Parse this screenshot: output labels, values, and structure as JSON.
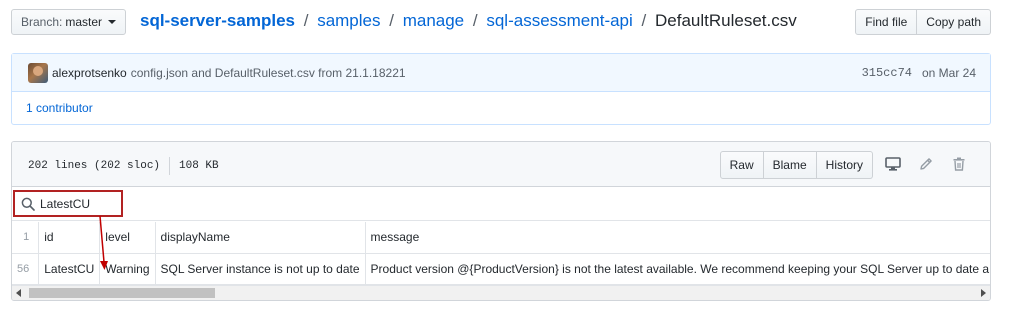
{
  "branch": {
    "label": "Branch:",
    "value": "master"
  },
  "breadcrumb": {
    "repo": "sql-server-samples",
    "segments": [
      "samples",
      "manage",
      "sql-assessment-api"
    ],
    "file": "DefaultRuleset.csv",
    "separator": "/"
  },
  "header_buttons": {
    "find_file": "Find file",
    "copy_path": "Copy path"
  },
  "commit": {
    "author": "alexprotsenko",
    "message": "config.json and DefaultRuleset.csv from 21.1.18221",
    "sha": "315cc74",
    "date": "on Mar 24"
  },
  "contributors": "1 contributor",
  "file": {
    "lines": "202 lines (202 sloc)",
    "size": "108 KB",
    "actions": [
      "Raw",
      "Blame",
      "History"
    ],
    "icons": [
      "desktop-icon",
      "pencil-icon",
      "trash-icon"
    ]
  },
  "search": {
    "query": "LatestCU"
  },
  "table": {
    "header": {
      "line": "1",
      "cells": [
        "id",
        "level",
        "displayName",
        "message"
      ]
    },
    "rows": [
      {
        "line": "56",
        "cells": [
          "LatestCU",
          "Warning",
          "SQL Server instance is not up to date",
          "Product version @{ProductVersion} is not the latest available. We recommend keeping your SQL Server up to date a"
        ]
      }
    ]
  },
  "colors": {
    "link": "#0366d6",
    "highlight_border": "#b22222",
    "arrow": "#c00000"
  }
}
